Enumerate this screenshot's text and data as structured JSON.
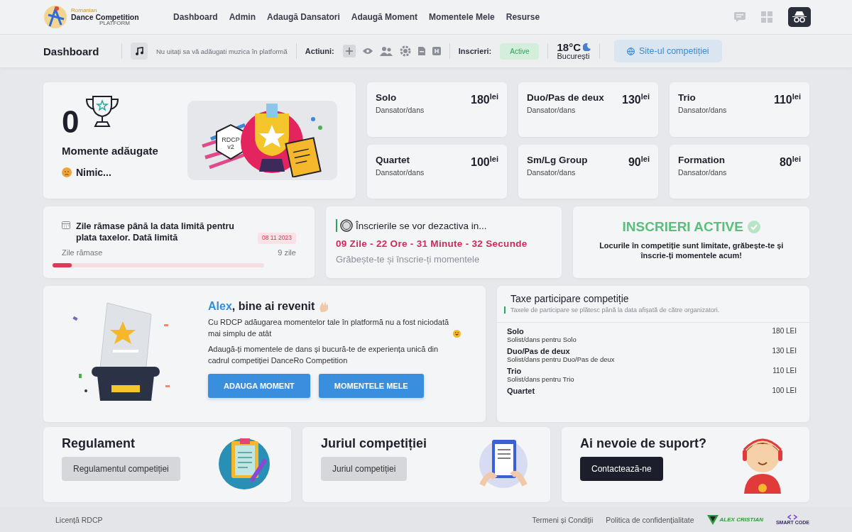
{
  "brand": {
    "line_1": "Romanian",
    "line_2": "Dance Competition",
    "line_3": "PLATFORM"
  },
  "nav": [
    {
      "label": "Dashboard"
    },
    {
      "label": "Admin"
    },
    {
      "label": "Adaugă Dansatori"
    },
    {
      "label": "Adaugă Moment"
    },
    {
      "label": "Momentele Mele"
    },
    {
      "label": "Resurse"
    }
  ],
  "toolbar": {
    "title": "Dashboard",
    "music_note": "Nu uitați sa vă adăugati muzica în platformă",
    "actions_label": "Actiuni:",
    "registrations_label": "Inscrieri:",
    "registrations_status": "Active",
    "temperature": "18°C",
    "city": "București",
    "site_link": "Site-ul competiției"
  },
  "summary": {
    "count": "0",
    "label": "Momente adăugate",
    "status": "Nimic...",
    "badge_line_1": "RDCP",
    "badge_line_2": "v2"
  },
  "prices": [
    {
      "name": "Solo",
      "amount": "180",
      "unit": "lei",
      "note": "Dansator/dans"
    },
    {
      "name": "Duo/Pas de deux",
      "amount": "130",
      "unit": "lei",
      "note": "Dansator/dans"
    },
    {
      "name": "Trio",
      "amount": "110",
      "unit": "lei",
      "note": "Dansator/dans"
    },
    {
      "name": "Quartet",
      "amount": "100",
      "unit": "lei",
      "note": "Dansator/dans"
    },
    {
      "name": "Sm/Lg Group",
      "amount": "90",
      "unit": "lei",
      "note": "Dansator/dans"
    },
    {
      "name": "Formation",
      "amount": "80",
      "unit": "lei",
      "note": "Dansator/dans"
    }
  ],
  "deadline": {
    "title": "Zile rămase până la data limită pentru plata taxelor.  Dată limită",
    "date": "08 11 2023",
    "label": "Zile rămase",
    "value": "9 zile",
    "level": 0.09
  },
  "countdown": {
    "title": "Înscrierile se vor dezactiva in...",
    "time": "09 Zile - 22 Ore - 31 Minute - 32 Secunde",
    "subtitle": "Grăbește-te și înscrie-ți momentele"
  },
  "status_card": {
    "title": "INSCRIERI ACTIVE",
    "text": "Locurile în competiție sunt limitate, grăbește-te și înscrie-ți momentele acum!"
  },
  "welcome": {
    "heading": "**Alex**, bine ai revenit",
    "paragraphs": [
      "Cu RDCP adăugarea momentelor tale în platformă nu a fost niciodată mai simplu de atât",
      "Adaugă-ți momentele de dans și bucură-te de experiența unică din cadrul competiției DanceRo Competition"
    ],
    "buttons": [
      "ADAUGA MOMENT",
      "MOMENTELE MELE"
    ]
  },
  "fees": {
    "title": "Taxe participare competiție",
    "subtitle": "Taxele de participare se plătesc până la data afișată de către organizatori.",
    "rows": [
      {
        "name": "Solo",
        "description": "Solist/dans pentru Solo",
        "price": "180 LEI"
      },
      {
        "name": "Duo/Pas de deux",
        "description": "Solist/dans pentru Duo/Pas de deux",
        "price": "130 LEI"
      },
      {
        "name": "Trio",
        "description": "Solist/dans pentru Trio",
        "price": "110 LEI"
      },
      {
        "name": "Quartet",
        "price": "100 LEI"
      }
    ]
  },
  "links": [
    {
      "title": "Regulament",
      "button": "Regulamentul competiției",
      "kind": "light"
    },
    {
      "title": "Juriul competiției",
      "button": "Juriul competiției",
      "kind": "light"
    },
    {
      "title": "Ai nevoie de suport?",
      "button": "Contactează-ne",
      "kind": "dark"
    }
  ],
  "footer": {
    "license": "Licență RDCP",
    "links": [
      "Termeni și Condiții",
      "Politica de confidențialitate"
    ],
    "logos": [
      "ALEX CRISTIAN",
      "SMART CODE"
    ]
  }
}
